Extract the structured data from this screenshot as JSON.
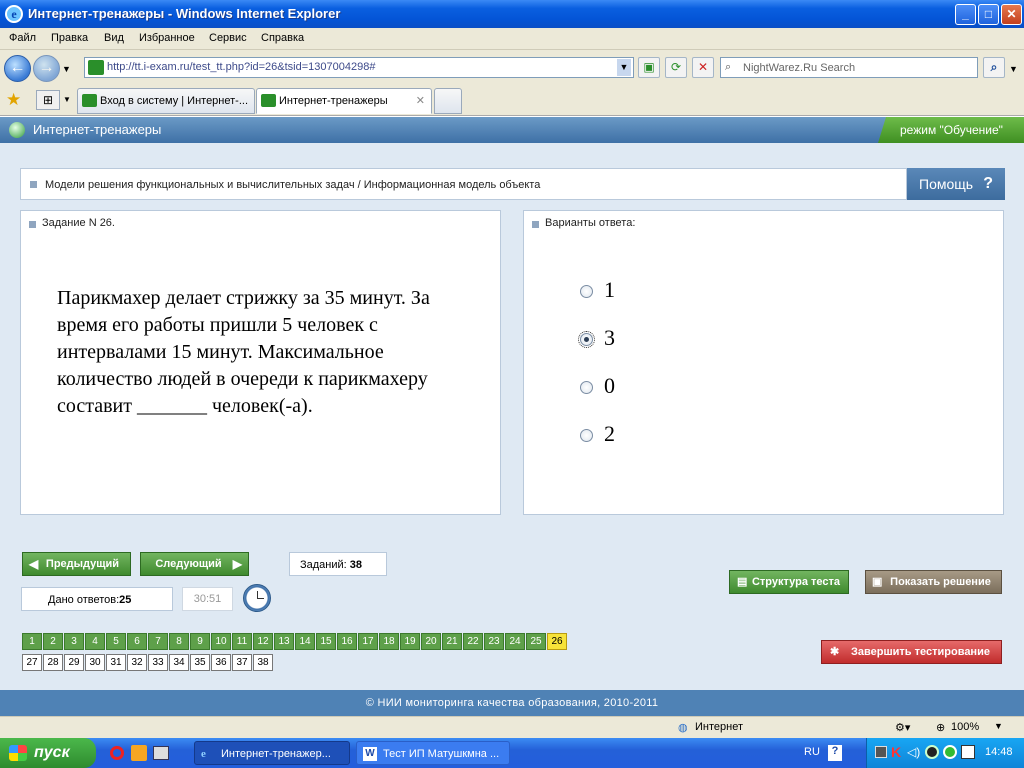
{
  "window": {
    "title": "Интернет-тренажеры - Windows Internet Explorer",
    "min": "_",
    "max": "□",
    "close": "✕"
  },
  "menu": [
    "Файл",
    "Правка",
    "Вид",
    "Избранное",
    "Сервис",
    "Справка"
  ],
  "address": {
    "url": "http://tt.i-exam.ru/test_tt.php?id=26&tsid=1307004298#"
  },
  "search": {
    "placeholder": "NightWarez.Ru Search"
  },
  "tabs": [
    {
      "label": "Вход в систему | Интернет-..."
    },
    {
      "label": "Интернет-тренажеры"
    }
  ],
  "app": {
    "name": "Интернет-тренажеры",
    "mode": "режим \"Обучение\""
  },
  "topic": {
    "text": "Модели решения функциональных и вычислительных задач / Информационная модель объекта"
  },
  "help": {
    "label": "Помощь",
    "icon": "?"
  },
  "question": {
    "header": "Задание N 26.",
    "text": "Парикмахер делает стрижку за 35 минут. За время его работы пришли  5 человек с интервалами 15 минут. Максимальное количество людей в очереди к  парикмахеру составит _______ человек(-а)."
  },
  "answers": {
    "header": "Варианты ответа:",
    "options": [
      "1",
      "3",
      "0",
      "2"
    ],
    "selected_index": 1
  },
  "controls": {
    "prev": "Предыдущий",
    "next": "Следующий",
    "tasks_label": "Заданий:",
    "tasks_count": "38",
    "answered_label": "Дано ответов:",
    "answered_count": "25",
    "timer": "30:51",
    "structure": "Структура теста",
    "show_solution": "Показать решение",
    "finish": "Завершить тестирование"
  },
  "question_nav": {
    "done": [
      "1",
      "2",
      "3",
      "4",
      "5",
      "6",
      "7",
      "8",
      "9",
      "10",
      "11",
      "12",
      "13",
      "14",
      "15",
      "16",
      "17",
      "18",
      "19",
      "20",
      "21",
      "22",
      "23",
      "24",
      "25"
    ],
    "current": "26",
    "todo": [
      "27",
      "28",
      "29",
      "30",
      "31",
      "32",
      "33",
      "34",
      "35",
      "36",
      "37",
      "38"
    ]
  },
  "footer": {
    "text": "© НИИ мониторинга качества образования, 2010-2011"
  },
  "status": {
    "zone": "Интернет",
    "zoom": "100%"
  },
  "taskbar": {
    "start": "пуск",
    "items": [
      "Интернет-тренажер...",
      "Тест ИП Матушкмна ..."
    ],
    "lang": "RU",
    "time": "14:48"
  }
}
